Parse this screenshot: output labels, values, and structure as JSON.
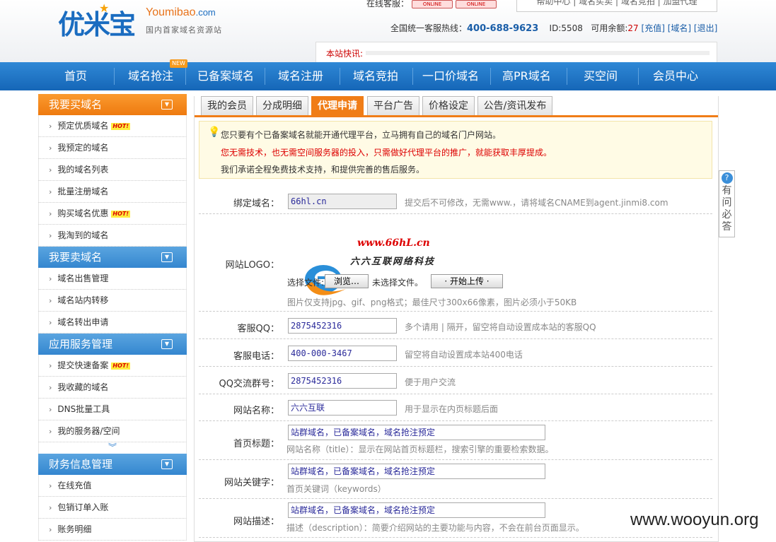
{
  "header": {
    "logo_cn": "优米宝",
    "logo_en": "Youmibao",
    "logo_en_suffix": ".com",
    "logo_sub": "国内首家域名资源站",
    "online_label": "在线客服：",
    "online_badge": "ONLINE",
    "top_links": "帮助中心 | 域名买卖 | 域名竞拍 | 加盟代理",
    "hotline_label": "全国统一客服热线：",
    "hotline_number": "400-688-9623",
    "user_id": "ID:5508",
    "balance_label": "可用余额:",
    "balance_value": "27",
    "recharge": "[充值]",
    "domain_link": "[域名]",
    "logout": "[退出]",
    "news_label": "本站快讯:"
  },
  "nav": {
    "items": [
      "首页",
      "域名抢注",
      "已备案域名",
      "域名注册",
      "域名竞拍",
      "一口价域名",
      "高PR域名",
      "买空间",
      "会员中心"
    ],
    "new_badge": "NEW"
  },
  "sidebar": {
    "groups": [
      {
        "title": "我要买域名",
        "items": [
          "预定优质域名",
          "我预定的域名",
          "我的域名列表",
          "批量注册域名",
          "购买域名优惠",
          "我淘到的域名"
        ]
      },
      {
        "title": "我要卖域名",
        "items": [
          "域名出售管理",
          "域名站内转移",
          "域名转出申请"
        ]
      },
      {
        "title": "应用服务管理",
        "items": [
          "提交快速备案",
          "我收藏的域名",
          "DNS批量工具",
          "我的服务器/空间"
        ]
      },
      {
        "title": "财务信息管理",
        "items": [
          "在线充值",
          "包销订单入账",
          "账务明细"
        ]
      }
    ],
    "hot_badge": "HOT!",
    "more": "︾"
  },
  "tabs": [
    "我的会员",
    "分成明细",
    "代理申请",
    "平台广告",
    "价格设定",
    "公告/资讯发布"
  ],
  "notice": {
    "line1": "您只要有个已备案域名就能开通代理平台，立马拥有自己的域名门户网站。",
    "line2": "您无需技术，也无需空间服务器的投入，只需做好代理平台的推广，就能获取丰厚提成。",
    "line3": "我们承诺全程免费技术支持，和提供完善的售后服务。"
  },
  "form": {
    "bind_domain": {
      "label": "绑定域名：",
      "value": "66hl.cn",
      "hint": "提交后不可修改，无需www.，请将域名CNAME到agent.jinmi8.com"
    },
    "logo": {
      "label": "网站LOGO：",
      "logo_url_text": "www.66hL.cn",
      "logo_cn_text": "六六互联网络科技",
      "choose_label": "选择文件:",
      "browse": "浏览…",
      "no_file": "未选择文件。",
      "upload": "· 开始上传 ·",
      "hint": "图片仅支持jpg、gif、png格式；最佳尺寸300x66像素，图片必须小于50KB"
    },
    "qq": {
      "label": "客服QQ：",
      "value": "2875452316",
      "hint": "多个请用 | 隔开，留空将自动设置成本站的客服QQ"
    },
    "phone": {
      "label": "客服电话：",
      "value": "400-000-3467",
      "hint": "留空将自动设置成本站400电话"
    },
    "qq_group": {
      "label": "QQ交流群号：",
      "value": "2875452316",
      "hint": "便于用户交流"
    },
    "site_name": {
      "label": "网站名称：",
      "value": "六六互联",
      "hint": "用于显示在内页标题后面"
    },
    "home_title": {
      "label": "首页标题：",
      "value": "站群域名，已备案域名，域名抢注预定",
      "hint": "网站名称（title）：显示在网站首页标题栏，搜索引擎的重要检索数据。"
    },
    "keywords": {
      "label": "网站关键字：",
      "value": "站群域名，已备案域名，域名抢注预定",
      "hint": "首页关键词（keywords）"
    },
    "description": {
      "label": "网站描述：",
      "value": "站群域名，已备案域名，域名抢注预定",
      "hint": "描述（description）：简要介绍网站的主要功能与内容，不会在前台页面显示。"
    }
  },
  "float_tab": {
    "icon": "?",
    "text": "有问必答"
  },
  "watermark": "www.wooyun.org",
  "colors": {
    "nav_blue": "#1f77c8",
    "accent_orange": "#f07d17",
    "warning_red": "#dd0000"
  }
}
